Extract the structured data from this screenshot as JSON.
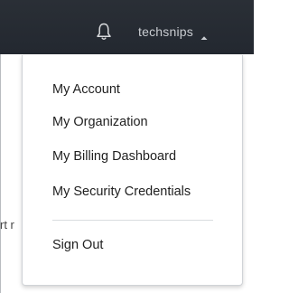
{
  "header": {
    "notifications_icon": "bell-icon",
    "user_name": "techsnips",
    "user_menu_icon": "caret-up-icon"
  },
  "background": {
    "partial_text": "rt r"
  },
  "dropdown": {
    "items": [
      {
        "label": "My Account"
      },
      {
        "label": "My Organization"
      },
      {
        "label": "My Billing Dashboard"
      },
      {
        "label": "My Security Credentials"
      }
    ],
    "sign_out_label": "Sign Out"
  }
}
